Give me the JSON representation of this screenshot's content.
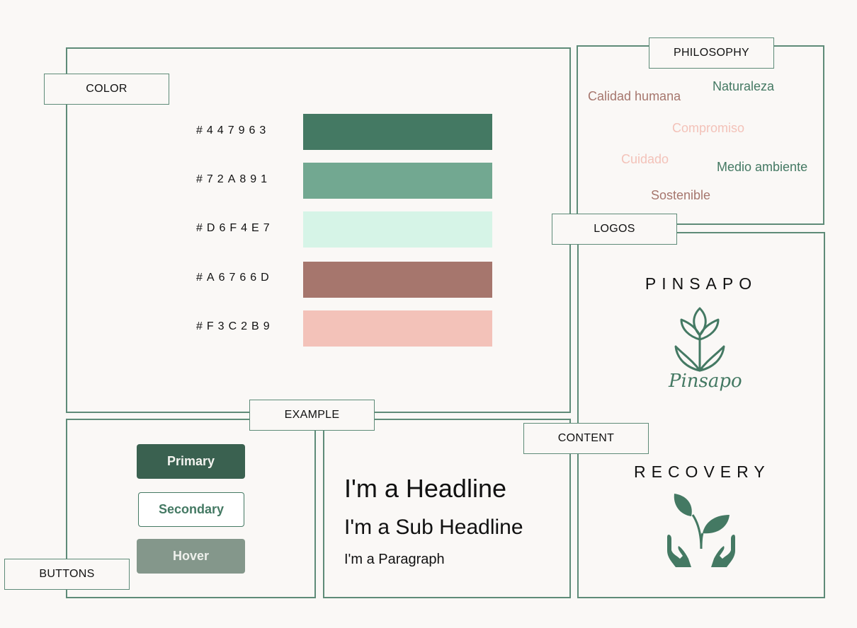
{
  "sections": {
    "color": "COLOR",
    "philosophy": "PHILOSOPHY",
    "logos": "LOGOS",
    "example": "EXAMPLE",
    "content": "CONTENT",
    "buttons": "BUTTONS"
  },
  "palette": [
    {
      "label": "#447963",
      "color": "#447963"
    },
    {
      "label": "#72A891",
      "color": "#72A891"
    },
    {
      "label": "#D6F4E7",
      "color": "#D6F4E7"
    },
    {
      "label": "#A6766D",
      "color": "#A6766D"
    },
    {
      "label": "#F3C2B9",
      "color": "#F3C2B9"
    }
  ],
  "philosophy": [
    {
      "text": "Calidad humana",
      "color": "#A6766D"
    },
    {
      "text": "Naturaleza",
      "color": "#447963"
    },
    {
      "text": "Compromiso",
      "color": "#F3C2B9"
    },
    {
      "text": "Cuidado",
      "color": "#F3C2B9"
    },
    {
      "text": "Medio ambiente",
      "color": "#447963"
    },
    {
      "text": "Sostenible",
      "color": "#A6766D"
    }
  ],
  "buttons": {
    "primary": "Primary",
    "secondary": "Secondary",
    "hover": "Hover"
  },
  "content": {
    "headline": "I'm a Headline",
    "subheadline": "I'm a Sub Headline",
    "paragraph": "I'm a Paragraph"
  },
  "logos": {
    "pinsapo_title": "PINSAPO",
    "pinsapo_script": "Pinsapo",
    "recovery_title": "RECOVERY"
  }
}
